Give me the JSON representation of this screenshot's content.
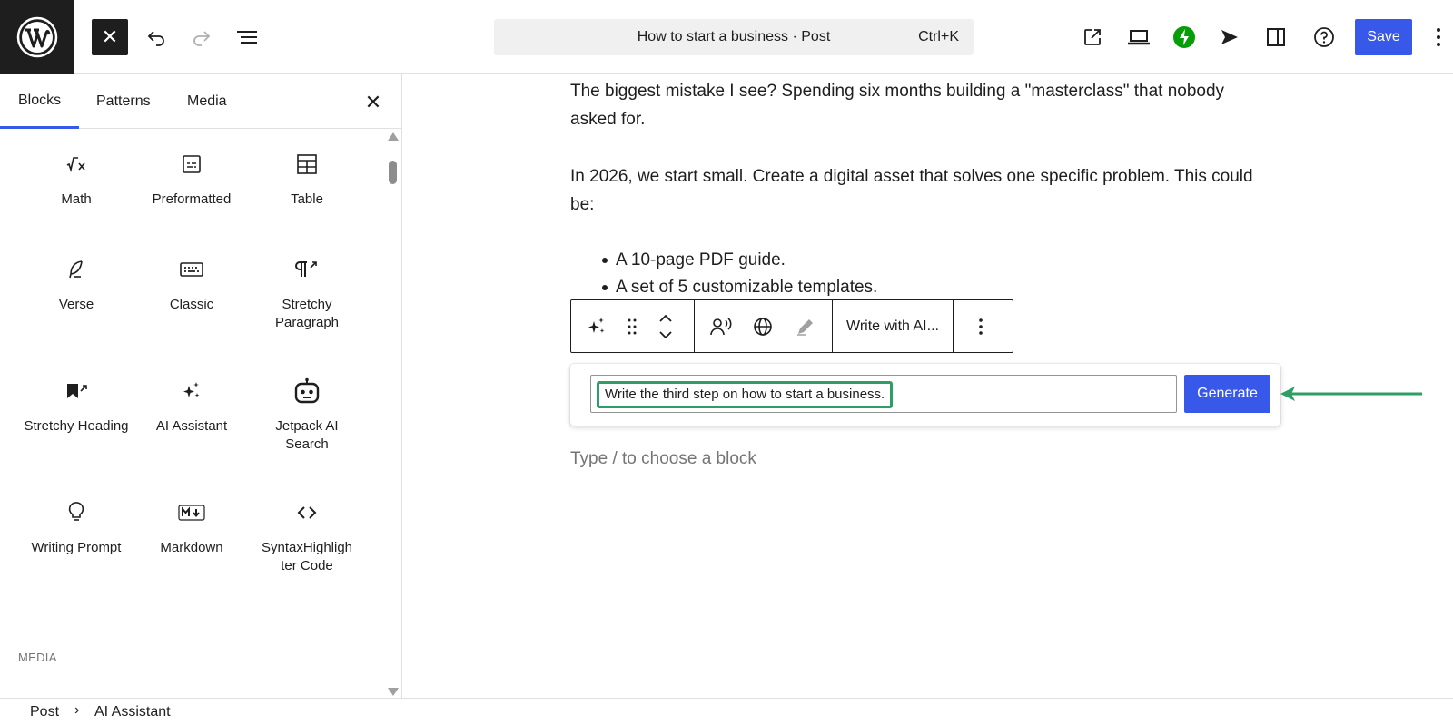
{
  "header": {
    "post_title": "How to start a business · Post",
    "shortcut": "Ctrl+K",
    "save_label": "Save"
  },
  "sidebar": {
    "tabs": [
      {
        "label": "Blocks",
        "active": true
      },
      {
        "label": "Patterns",
        "active": false
      },
      {
        "label": "Media",
        "active": false
      }
    ],
    "blocks": [
      {
        "label": "Math",
        "icon": "math-icon"
      },
      {
        "label": "Preformatted",
        "icon": "preformatted-icon"
      },
      {
        "label": "Table",
        "icon": "table-icon"
      },
      {
        "label": "Verse",
        "icon": "feather-icon"
      },
      {
        "label": "Classic",
        "icon": "keyboard-icon"
      },
      {
        "label": "Stretchy Paragraph",
        "icon": "paragraph-icon"
      },
      {
        "label": "Stretchy Heading",
        "icon": "bookmark-icon"
      },
      {
        "label": "AI Assistant",
        "icon": "sparkles-icon"
      },
      {
        "label": "Jetpack AI Search",
        "icon": "robot-icon"
      },
      {
        "label": "Writing Prompt",
        "icon": "lightbulb-icon"
      },
      {
        "label": "Markdown",
        "icon": "markdown-icon"
      },
      {
        "label": "SyntaxHighligh ter Code",
        "icon": "code-icon"
      }
    ],
    "media_heading": "MEDIA"
  },
  "editor": {
    "paragraphs": [
      "The biggest mistake I see? Spending six months building a \"masterclass\" that nobody asked for.",
      "In 2026, we start small. Create a digital asset that solves one specific problem. This could be:"
    ],
    "list_items": [
      "A 10-page PDF guide.",
      "A set of 5 customizable templates."
    ],
    "toolbar": {
      "write_with_ai": "Write with AI..."
    },
    "ai_prompt": {
      "value": "Write the third step on how to start a business.",
      "generate_label": "Generate"
    },
    "placeholder": "Type / to choose a block"
  },
  "breadcrumb": {
    "items": [
      "Post",
      "AI Assistant"
    ]
  },
  "colors": {
    "accent": "#3858e9",
    "highlight": "#2e9e66",
    "jetpack": "#069e08"
  }
}
